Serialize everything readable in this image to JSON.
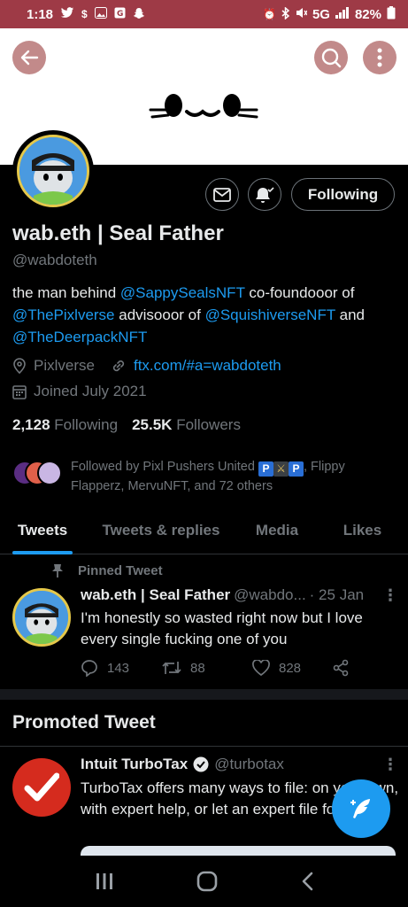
{
  "status_bar": {
    "time": "1:18",
    "left_icons": [
      "twitter-icon",
      "dollar-icon",
      "gallery-icon",
      "app-icon",
      "snapchat-icon"
    ],
    "network": "5G",
    "battery": "82%"
  },
  "header": {
    "back_icon": "back-arrow-icon",
    "search_icon": "search-icon",
    "more_icon": "more-vertical-icon"
  },
  "profile": {
    "name": "wab.eth | Seal Father",
    "handle": "@wabdoteth",
    "following_button": "Following",
    "bio": {
      "p1": "the man behind ",
      "m1": "@SappySealsNFT",
      "p2": "  co-foundooor of",
      "m2": "@ThePixlverse",
      "p3": "  advisooor of ",
      "m3": "@SquishiverseNFT",
      "p4": " and",
      "m4": "@TheDeerpackNFT"
    },
    "location": "Pixlverse",
    "website": "ftx.com/#a=wabdoteth",
    "joined": "Joined July 2021",
    "following_count": "2,128",
    "following_label": "Following",
    "followers_count": "25.5K",
    "followers_label": "Followers",
    "followed_by": {
      "prefix": "Followed by Pixl Pushers United ",
      "suffix": ", Flippy Flapperz, MervuNFT, and 72 others"
    }
  },
  "tabs": [
    {
      "label": "Tweets",
      "active": true
    },
    {
      "label": "Tweets & replies",
      "active": false
    },
    {
      "label": "Media",
      "active": false
    },
    {
      "label": "Likes",
      "active": false
    }
  ],
  "pinned_tweet": {
    "pinned_label": "Pinned Tweet",
    "author": "wab.eth | Seal Father",
    "handle": "@wabdo...",
    "date": "· 25 Jan",
    "text": "I'm honestly so wasted right now but I love every single fucking one of you",
    "replies": "143",
    "retweets": "88",
    "likes": "828"
  },
  "promoted": {
    "section_title": "Promoted Tweet",
    "author": "Intuit TurboTax",
    "handle": "@turbotax",
    "text": "TurboTax offers many ways to file: on your own, with expert help, or let an expert file for you."
  },
  "colors": {
    "accent": "#1d9bf0",
    "status_bar": "#9e3a46",
    "background": "#000000",
    "turbotax_red": "#d52b1e"
  }
}
